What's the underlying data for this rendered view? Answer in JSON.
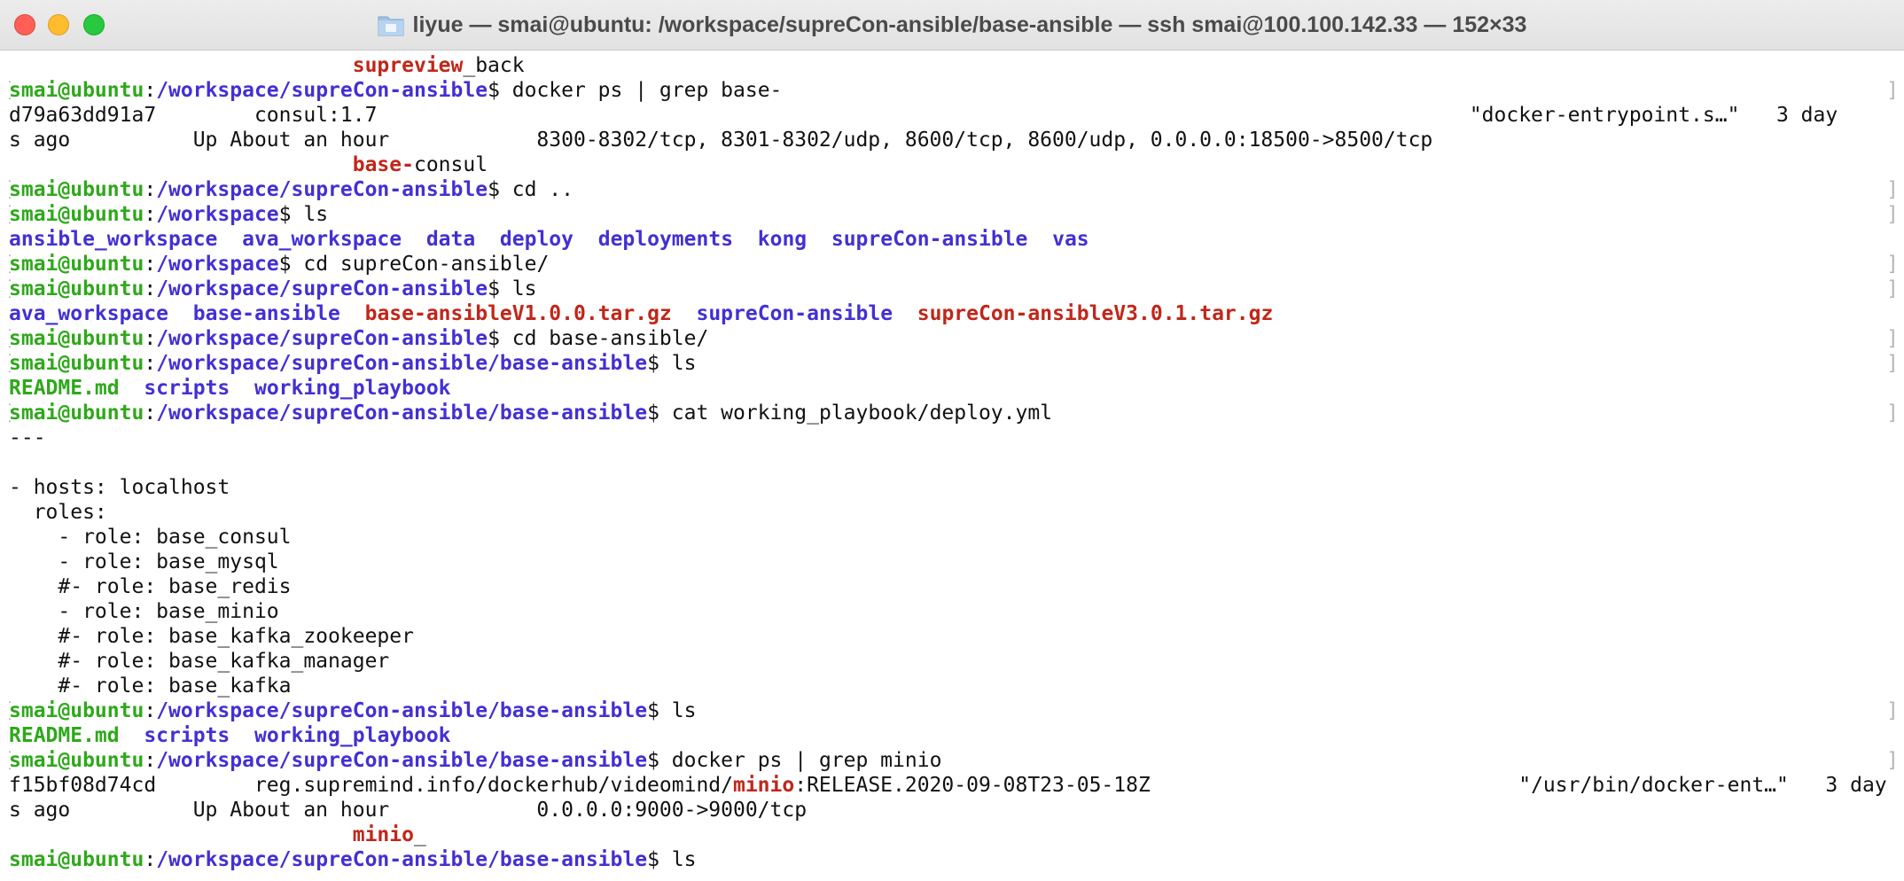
{
  "window": {
    "title": "liyue — smai@ubuntu: /workspace/supreCon-ansible/base-ansible — ssh smai@100.100.142.33 — 152×33"
  },
  "colors": {
    "prompt_user": "#2fa81b",
    "prompt_path": "#4330d3",
    "directory": "#4330d3",
    "archive": "#c0271a",
    "executable": "#2fa81b",
    "grep_match": "#c0271a"
  },
  "lines": [
    {
      "type": "segments",
      "segments": [
        {
          "t": "                            "
        },
        {
          "t": "supreview",
          "c": "hl"
        },
        {
          "t": "_back"
        }
      ]
    },
    {
      "type": "prompt",
      "user": "smai@ubuntu",
      "path": "/workspace/supreCon-ansible",
      "cmd": "$ docker ps | grep base-",
      "bracket": true
    },
    {
      "type": "segments",
      "segments": [
        {
          "t": "d79a63dd91a7        consul:1.7                                                                                         \"docker-entrypoint.s…\"   3 day"
        }
      ]
    },
    {
      "type": "segments",
      "segments": [
        {
          "t": "s ago          Up About an hour            8300-8302/tcp, 8301-8302/udp, 8600/tcp, 8600/udp, 0.0.0.0:18500->8500/tcp"
        }
      ]
    },
    {
      "type": "segments",
      "segments": [
        {
          "t": "                            "
        },
        {
          "t": "base-",
          "c": "hl"
        },
        {
          "t": "consul"
        }
      ]
    },
    {
      "type": "prompt",
      "user": "smai@ubuntu",
      "path": "/workspace/supreCon-ansible",
      "cmd": "$ cd ..",
      "bracket": true
    },
    {
      "type": "prompt",
      "user": "smai@ubuntu",
      "path": "/workspace",
      "cmd": "$ ls",
      "bracket": true
    },
    {
      "type": "segments",
      "segments": [
        {
          "t": "ansible_workspace",
          "c": "dir"
        },
        {
          "t": "  "
        },
        {
          "t": "ava_workspace",
          "c": "dir"
        },
        {
          "t": "  "
        },
        {
          "t": "data",
          "c": "dir"
        },
        {
          "t": "  "
        },
        {
          "t": "deploy",
          "c": "dir"
        },
        {
          "t": "  "
        },
        {
          "t": "deployments",
          "c": "dir"
        },
        {
          "t": "  "
        },
        {
          "t": "kong",
          "c": "dir"
        },
        {
          "t": "  "
        },
        {
          "t": "supreCon-ansible",
          "c": "dir"
        },
        {
          "t": "  "
        },
        {
          "t": "vas",
          "c": "dir"
        }
      ]
    },
    {
      "type": "prompt",
      "user": "smai@ubuntu",
      "path": "/workspace",
      "cmd": "$ cd supreCon-ansible/",
      "bracket": true
    },
    {
      "type": "prompt",
      "user": "smai@ubuntu",
      "path": "/workspace/supreCon-ansible",
      "cmd": "$ ls",
      "bracket": true
    },
    {
      "type": "segments",
      "segments": [
        {
          "t": "ava_workspace",
          "c": "dir"
        },
        {
          "t": "  "
        },
        {
          "t": "base-ansible",
          "c": "dir"
        },
        {
          "t": "  "
        },
        {
          "t": "base-ansibleV1.0.0.tar.gz",
          "c": "red"
        },
        {
          "t": "  "
        },
        {
          "t": "supreCon-ansible",
          "c": "dir"
        },
        {
          "t": "  "
        },
        {
          "t": "supreCon-ansibleV3.0.1.tar.gz",
          "c": "red"
        }
      ]
    },
    {
      "type": "prompt",
      "user": "smai@ubuntu",
      "path": "/workspace/supreCon-ansible",
      "cmd": "$ cd base-ansible/",
      "bracket": true
    },
    {
      "type": "prompt",
      "user": "smai@ubuntu",
      "path": "/workspace/supreCon-ansible/base-ansible",
      "cmd": "$ ls",
      "bracket": true
    },
    {
      "type": "segments",
      "segments": [
        {
          "t": "README.md",
          "c": "green"
        },
        {
          "t": "  "
        },
        {
          "t": "scripts",
          "c": "dir"
        },
        {
          "t": "  "
        },
        {
          "t": "working_playbook",
          "c": "dir"
        }
      ]
    },
    {
      "type": "prompt",
      "user": "smai@ubuntu",
      "path": "/workspace/supreCon-ansible/base-ansible",
      "cmd": "$ cat working_playbook/deploy.yml",
      "bracket": true
    },
    {
      "type": "segments",
      "segments": [
        {
          "t": "---"
        }
      ]
    },
    {
      "type": "segments",
      "segments": [
        {
          "t": ""
        }
      ]
    },
    {
      "type": "segments",
      "segments": [
        {
          "t": "- hosts: localhost"
        }
      ]
    },
    {
      "type": "segments",
      "segments": [
        {
          "t": "  roles:"
        }
      ]
    },
    {
      "type": "segments",
      "segments": [
        {
          "t": "    - role: base_consul"
        }
      ]
    },
    {
      "type": "segments",
      "segments": [
        {
          "t": "    - role: base_mysql"
        }
      ]
    },
    {
      "type": "segments",
      "segments": [
        {
          "t": "    #- role: base_redis"
        }
      ]
    },
    {
      "type": "segments",
      "segments": [
        {
          "t": "    - role: base_minio"
        }
      ]
    },
    {
      "type": "segments",
      "segments": [
        {
          "t": "    #- role: base_kafka_zookeeper"
        }
      ]
    },
    {
      "type": "segments",
      "segments": [
        {
          "t": "    #- role: base_kafka_manager"
        }
      ]
    },
    {
      "type": "segments",
      "segments": [
        {
          "t": "    #- role: base_kafka"
        }
      ]
    },
    {
      "type": "prompt",
      "user": "smai@ubuntu",
      "path": "/workspace/supreCon-ansible/base-ansible",
      "cmd": "$ ls",
      "bracket": true
    },
    {
      "type": "segments",
      "segments": [
        {
          "t": "README.md",
          "c": "green"
        },
        {
          "t": "  "
        },
        {
          "t": "scripts",
          "c": "dir"
        },
        {
          "t": "  "
        },
        {
          "t": "working_playbook",
          "c": "dir"
        }
      ]
    },
    {
      "type": "prompt",
      "user": "smai@ubuntu",
      "path": "/workspace/supreCon-ansible/base-ansible",
      "cmd": "$ docker ps | grep minio",
      "bracket": true
    },
    {
      "type": "segments",
      "segments": [
        {
          "t": "f15bf08d74cd        reg.supremind.info/dockerhub/videomind/"
        },
        {
          "t": "minio",
          "c": "hl"
        },
        {
          "t": ":RELEASE.2020-09-08T23-05-18Z                              \"/usr/bin/docker-ent…\"   3 day"
        }
      ]
    },
    {
      "type": "segments",
      "segments": [
        {
          "t": "s ago          Up About an hour            0.0.0.0:9000->9000/tcp"
        }
      ]
    },
    {
      "type": "segments",
      "segments": [
        {
          "t": "                            "
        },
        {
          "t": "minio",
          "c": "hl"
        },
        {
          "t": "_"
        }
      ]
    },
    {
      "type": "prompt",
      "user": "smai@ubuntu",
      "path": "/workspace/supreCon-ansible/base-ansible",
      "cmd": "$ ls",
      "bracket": false
    }
  ]
}
